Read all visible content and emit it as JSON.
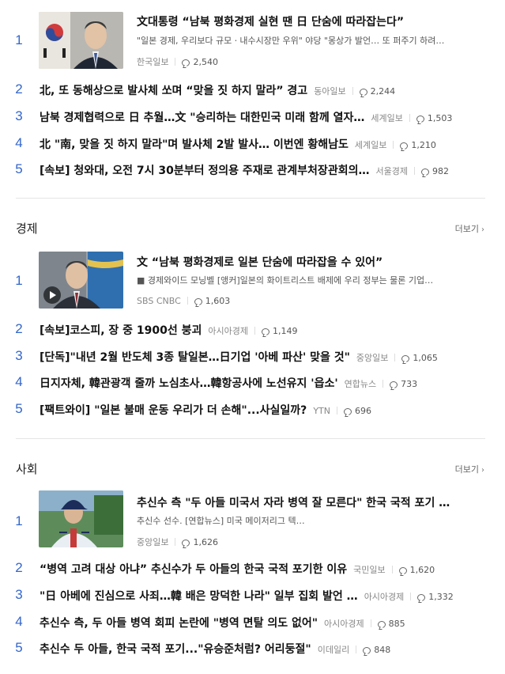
{
  "sections": [
    {
      "title": "",
      "more": "",
      "lead": {
        "rank": "1",
        "title": "文대통령 “남북 평화경제 실현 땐 日 단숨에 따라잡는다”",
        "desc": "\"일본 경제, 우리보다 규모ㆍ내수시장만 우위\" 야당 \"몽상가 발언… 또 퍼주기 하려…",
        "source": "한국일보",
        "comments": "2,540",
        "thumb_icon": "photo-president-with-flag"
      },
      "items": [
        {
          "rank": "2",
          "title": "北, 또 동해상으로 발사체 쏘며 “맞을 짓 하지 말라” 경고",
          "source": "동아일보",
          "comments": "2,244"
        },
        {
          "rank": "3",
          "title": "남북 경제협력으로 日 추월…文 \"승리하는 대한민국 미래 함께 열자…",
          "source": "세계일보",
          "comments": "1,503"
        },
        {
          "rank": "4",
          "title": "北 \"南, 맞을 짓 하지 말라\"며 발사체 2발 발사… 이번엔 황해남도",
          "source": "세계일보",
          "comments": "1,210"
        },
        {
          "rank": "5",
          "title": "[속보] 청와대, 오전 7시 30분부터 정의용 주재로 관계부처장관회의…",
          "source": "서울경제",
          "comments": "982"
        }
      ]
    },
    {
      "title": "경제",
      "more": "더보기",
      "lead": {
        "rank": "1",
        "title": "文 “남북 평화경제로 일본 단숨에 따라잡을 수 있어”",
        "desc": "■ 경제와이드 모닝벨 [앵커]일본의 화이트리스트 배제에 우리 정부는 물론 기업…",
        "source": "SBS CNBC",
        "comments": "1,603",
        "thumb_icon": "video-president-speech"
      },
      "items": [
        {
          "rank": "2",
          "title": "[속보]코스피, 장 중 1900선 붕괴",
          "source": "아시아경제",
          "comments": "1,149"
        },
        {
          "rank": "3",
          "title": "[단독]\"내년 2월 반도체 3종 탈일본…日기업 '아베 파산' 맞을 것\"",
          "source": "중앙일보",
          "comments": "1,065"
        },
        {
          "rank": "4",
          "title": "日지자체, 韓관광객 줄까 노심초사…韓항공사에 노선유지 '읍소'",
          "source": "연합뉴스",
          "comments": "733"
        },
        {
          "rank": "5",
          "title": "[팩트와이] \"일본 불매 운동 우리가 더 손해\"...사실일까?",
          "source": "YTN",
          "comments": "696"
        }
      ]
    },
    {
      "title": "사회",
      "more": "더보기",
      "lead": {
        "rank": "1",
        "title": "추신수 측 \"두 아들 미국서 자라 병역 잘 모른다\" 한국 국적 포기 …",
        "desc": "추신수 선수. [연합뉴스] 미국 메이저리그 텍…",
        "source": "중앙일보",
        "comments": "1,626",
        "thumb_icon": "photo-baseball-player"
      },
      "items": [
        {
          "rank": "2",
          "title": "“병역 고려 대상 아냐” 추신수가 두 아들의 한국 국적 포기한 이유",
          "source": "국민일보",
          "comments": "1,620"
        },
        {
          "rank": "3",
          "title": "\"日 아베에 진심으로 사죄…韓 배은 망덕한 나라\" 일부 집회 발언 …",
          "source": "아시아경제",
          "comments": "1,332"
        },
        {
          "rank": "4",
          "title": "추신수 측, 두 아들 병역 회피 논란에 \"병역 면탈 의도 없어\"",
          "source": "아시아경제",
          "comments": "885"
        },
        {
          "rank": "5",
          "title": "추신수 두 아들, 한국 국적 포기...\"유승준처럼? 어리둥절\"",
          "source": "이데일리",
          "comments": "848"
        }
      ]
    }
  ]
}
